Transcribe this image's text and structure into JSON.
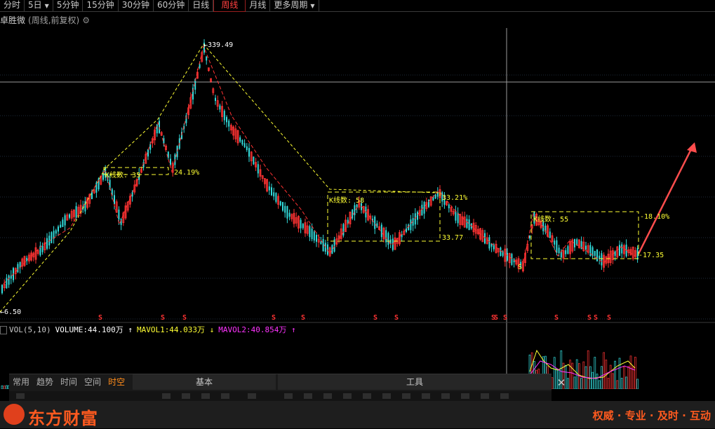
{
  "tabbar": {
    "tabs": [
      {
        "label": "分时",
        "active": false
      },
      {
        "label": "5日",
        "active": false,
        "dropdown": true
      },
      {
        "label": "5分钟",
        "active": false
      },
      {
        "label": "15分钟",
        "active": false
      },
      {
        "label": "30分钟",
        "active": false
      },
      {
        "label": "60分钟",
        "active": false
      },
      {
        "label": "日线",
        "active": false
      },
      {
        "label": "周线",
        "active": true
      },
      {
        "label": "月线",
        "active": false
      },
      {
        "label": "更多周期",
        "active": false,
        "dropdown": true
      }
    ]
  },
  "stock": {
    "name": "卓胜微",
    "subtitle": "(周线,前复权)",
    "settings_icon": "gear-icon"
  },
  "price_labels": {
    "high": "339.49",
    "low": "6.50",
    "pct1": "24.19%",
    "pct2": "33.21%",
    "pct3": "33.77",
    "pct4": "18.10%",
    "last": "17.35"
  },
  "box_labels": {
    "b1": "K线数: 35",
    "b2": "K线数: 58",
    "b3": "K线数: 55"
  },
  "signal_mark": "S",
  "volume": {
    "indicator": "VOL(5,10)",
    "volume": "VOLUME:44.100万",
    "mavol1": "MAVOL1:44.033万",
    "mavol2": "MAVOL2:40.854万",
    "up_arrow": "↑",
    "down_arrow": "↓"
  },
  "panel": {
    "tabs": [
      {
        "label": "常用",
        "active": false
      },
      {
        "label": "趋势",
        "active": false
      },
      {
        "label": "时间",
        "active": false
      },
      {
        "label": "空间",
        "active": false
      },
      {
        "label": "时空",
        "active": true
      }
    ],
    "header_basic": "基本",
    "header_tools": "工具",
    "close": "✕"
  },
  "footer": {
    "brand": "东方财富",
    "slogan": "权威 · 专业 · 及时 · 互动"
  },
  "colors": {
    "up": "#ff3333",
    "down": "#33dddd",
    "accent": "#ff5a1f",
    "wave_line": "#ffff33",
    "mavol2": "#ff33ff"
  }
}
